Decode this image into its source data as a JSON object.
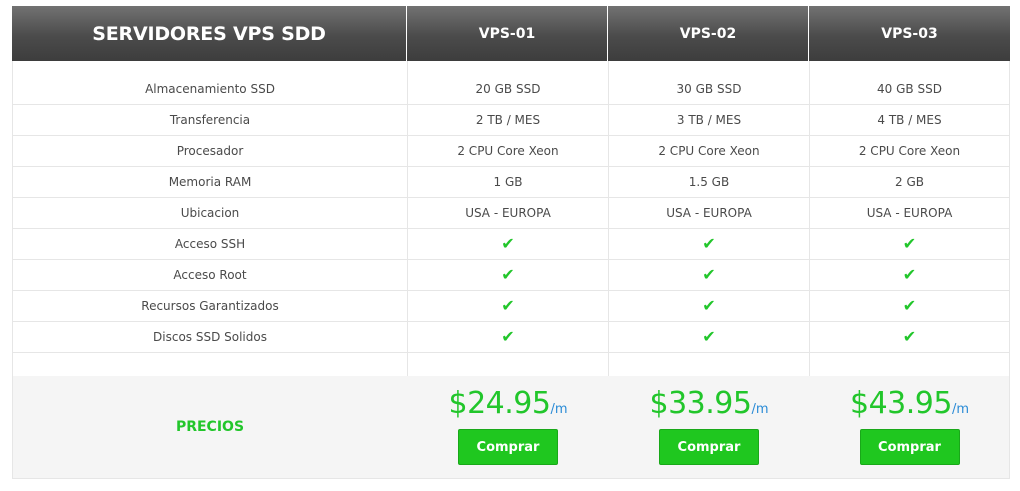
{
  "header": {
    "title": "SERVIDORES VPS SDD",
    "plans": [
      "VPS-01",
      "VPS-02",
      "VPS-03"
    ]
  },
  "features": [
    {
      "label": "Almacenamiento SSD",
      "values": [
        "20 GB SSD",
        "30 GB SSD",
        "40 GB SSD"
      ]
    },
    {
      "label": "Transferencia",
      "values": [
        "2 TB / MES",
        "3 TB / MES",
        "4 TB / MES"
      ]
    },
    {
      "label": "Procesador",
      "values": [
        "2 CPU Core Xeon",
        "2 CPU Core Xeon",
        "2 CPU Core Xeon"
      ]
    },
    {
      "label": "Memoria RAM",
      "values": [
        "1 GB",
        "1.5 GB",
        "2 GB"
      ]
    },
    {
      "label": "Ubicacion",
      "values": [
        "USA - EUROPA",
        "USA - EUROPA",
        "USA - EUROPA"
      ]
    },
    {
      "label": "Acceso SSH",
      "values": [
        "✔",
        "✔",
        "✔"
      ]
    },
    {
      "label": "Acceso Root",
      "values": [
        "✔",
        "✔",
        "✔"
      ]
    },
    {
      "label": "Recursos Garantizados",
      "values": [
        "✔",
        "✔",
        "✔"
      ]
    },
    {
      "label": "Discos SSD Solidos",
      "values": [
        "✔",
        "✔",
        "✔"
      ]
    }
  ],
  "pricing": {
    "label": "PRECIOS",
    "per": "/m",
    "button_label": "Comprar",
    "amounts": [
      "$24.95",
      "$33.95",
      "$43.95"
    ]
  },
  "colors": {
    "accent_green": "#22c62b",
    "per_blue": "#2a8bd6",
    "header_dark": "#4b4b4b"
  }
}
